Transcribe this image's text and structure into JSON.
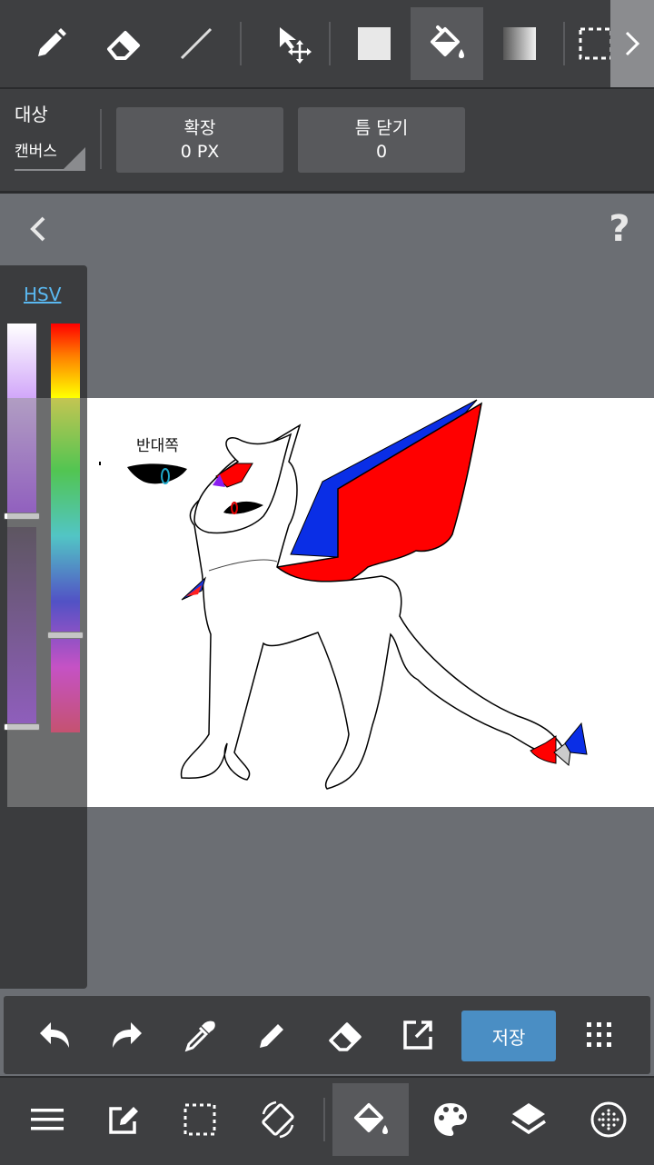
{
  "top_toolbar": {
    "tools": [
      {
        "name": "pen-icon"
      },
      {
        "name": "eraser-icon"
      },
      {
        "name": "line-icon"
      },
      {
        "name": "move-icon"
      },
      {
        "name": "fill-shape-icon"
      },
      {
        "name": "bucket-icon",
        "active": true
      },
      {
        "name": "gradient-icon"
      },
      {
        "name": "selection-icon"
      }
    ]
  },
  "sub_toolbar": {
    "target_label": "대상",
    "target_value": "캔버스",
    "expand_label": "확장",
    "expand_value": "0 PX",
    "gap_close_label": "틈 닫기",
    "gap_close_value": "0"
  },
  "canvas": {
    "help": "?",
    "annotation_text": "반대쪽"
  },
  "color_panel": {
    "tab": "HSV",
    "colors": {
      "saturation_top": "#8a1cf0",
      "hue_selected": "#7a00ff"
    }
  },
  "bottom_toolbar": {
    "save_label": "저장"
  },
  "colors": {
    "toolbar_bg": "#3e3f41",
    "active_bg": "#58595c",
    "accent": "#4a8ec4",
    "canvas_bg": "#6b6e73"
  }
}
